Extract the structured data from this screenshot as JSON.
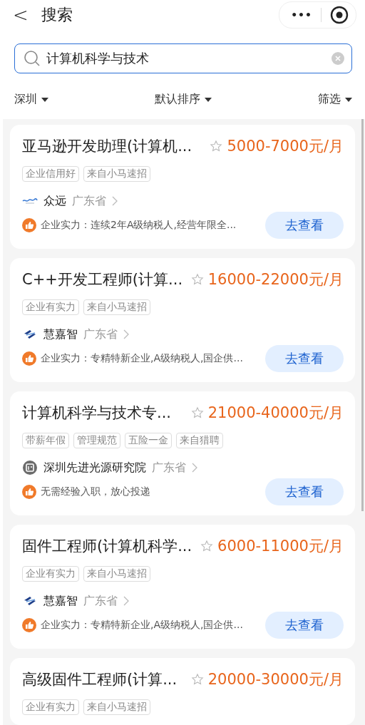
{
  "header": {
    "back": "<",
    "title": "搜索",
    "more": "•••"
  },
  "search": {
    "value": "计算机科学与技术"
  },
  "filters": [
    {
      "label": "深圳"
    },
    {
      "label": "默认排序"
    },
    {
      "label": "筛选"
    }
  ],
  "jobs": [
    {
      "title": "亚马逊开发助理(计算机...",
      "salary": "5000-7000元/月",
      "tags": [
        "企业信用好",
        "来自小马速招"
      ],
      "company": "众远",
      "logo": {
        "kind": "wave"
      },
      "region": "广东省",
      "note": "企业实力：连续2年A级纳税人,经营年限全...",
      "action": "去查看"
    },
    {
      "title": "C++开发工程师(计算...",
      "salary": "16000-22000元/月",
      "tags": [
        "企业有实力",
        "来自小马速招"
      ],
      "company": "慧嘉智",
      "logo": {
        "kind": "arrows"
      },
      "region": "广东省",
      "note": "企业实力：专精特新企业,A级纳税人,国企供...",
      "action": "去查看"
    },
    {
      "title": "计算机科学与技术专...",
      "salary": "21000-40000元/月",
      "tags": [
        "带薪年假",
        "管理规范",
        "五险一金",
        "来自猎聘"
      ],
      "company": "深圳先进光源研究院",
      "logo": {
        "kind": "building"
      },
      "region": "广东省",
      "note": "无需经验入职，放心投递",
      "action": "去查看"
    },
    {
      "title": "固件工程师(计算机科学...",
      "salary": "6000-11000元/月",
      "tags": [
        "企业有实力",
        "来自小马速招"
      ],
      "company": "慧嘉智",
      "logo": {
        "kind": "arrows"
      },
      "region": "广东省",
      "note": "企业实力：专精特新企业,A级纳税人,国企供...",
      "action": "去查看"
    },
    {
      "title": "高级固件工程师(计算...",
      "salary": "20000-30000元/月",
      "tags": [
        "企业有实力",
        "来自小马速招"
      ]
    }
  ]
}
